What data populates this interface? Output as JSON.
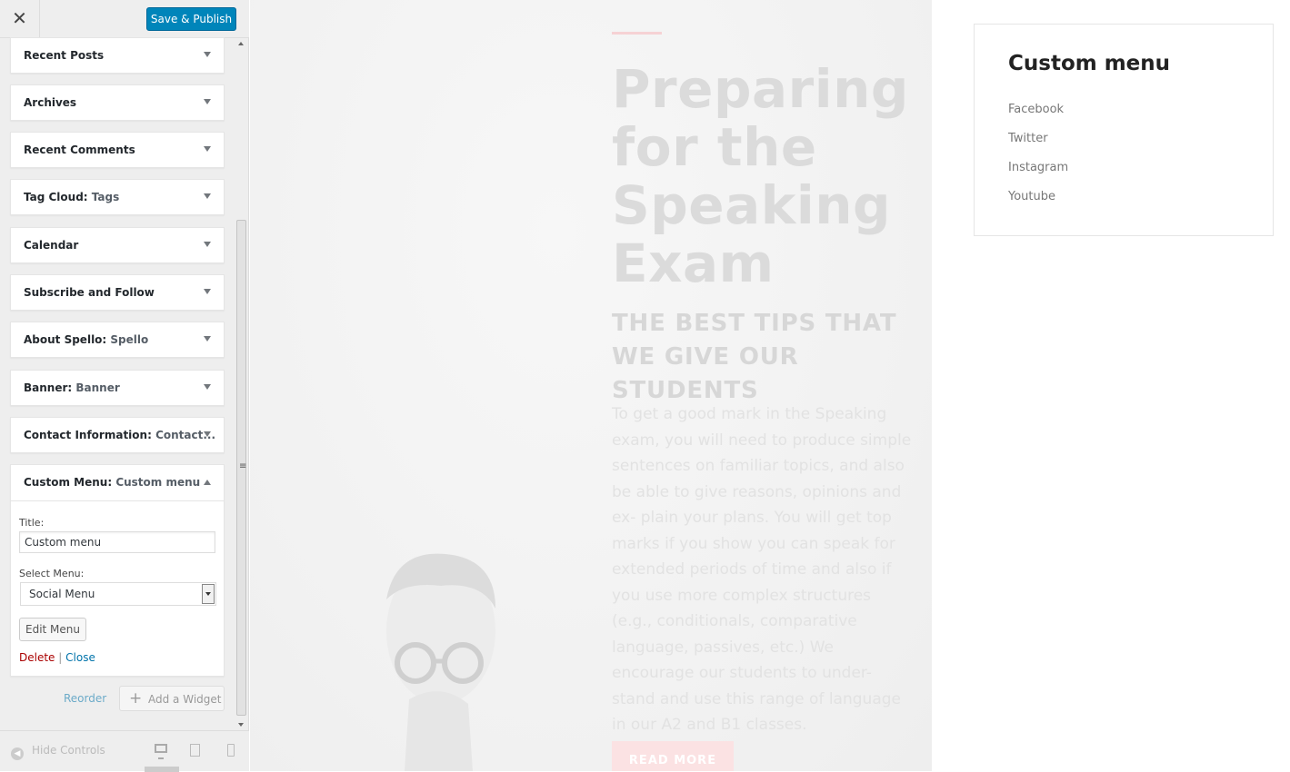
{
  "header": {
    "close_icon": "close-icon",
    "close_glyph": "✕",
    "publish_label": "Save & Publish",
    "publish_color": "#0085ba"
  },
  "widgets": [
    {
      "label": "Recent Posts",
      "sub": ""
    },
    {
      "label": "Archives",
      "sub": ""
    },
    {
      "label": "Recent Comments",
      "sub": ""
    },
    {
      "label": "Tag Cloud:",
      "sub": "Tags"
    },
    {
      "label": "Calendar",
      "sub": ""
    },
    {
      "label": "Subscribe and Follow",
      "sub": ""
    },
    {
      "label": "About Spello:",
      "sub": "Spello"
    },
    {
      "label": "Banner:",
      "sub": "Banner"
    },
    {
      "label": "Contact Information:",
      "sub": "Contact..."
    },
    {
      "label": "Custom Menu:",
      "sub": "Custom menu"
    }
  ],
  "custom_menu_form": {
    "title_label": "Title:",
    "title_value": "Custom menu",
    "select_label": "Select Menu:",
    "select_value": "Social Menu",
    "edit_button": "Edit Menu",
    "delete_link": "Delete",
    "separator": "|",
    "close_link": "Close"
  },
  "widget_area_actions": {
    "reorder": "Reorder",
    "add_widget": "Add a Widget",
    "add_glyph": "+"
  },
  "scrollbar": {
    "grip_glyph": "≡"
  },
  "footer": {
    "hide_controls": "Hide Controls",
    "hide_glyph": "◀",
    "devices": [
      "desktop-icon",
      "tablet-icon",
      "mobile-icon"
    ]
  },
  "preview": {
    "hero_title": "Preparing for the Speaking Exam",
    "hero_subtitle": "THE BEST TIPS THAT WE GIVE OUR STUDENTS",
    "hero_body": "To get a good mark in the Speaking exam, you will need to produce simple sentences on familiar topics, and also be able to give reasons, opinions and ex- plain your plans. You will get top marks if you show you can speak for extended periods of time and also if you use more complex structures (e.g., conditionals, comparative language, passives, etc.) We encourage our students to under- stand and use this range of language in our A2 and B1 classes.",
    "read_more": "READ MORE",
    "accent_color": "#f6d2d4",
    "custom_menu_widget": {
      "heading": "Custom menu",
      "links": [
        "Facebook",
        "Twitter",
        "Instagram",
        "Youtube"
      ]
    }
  }
}
